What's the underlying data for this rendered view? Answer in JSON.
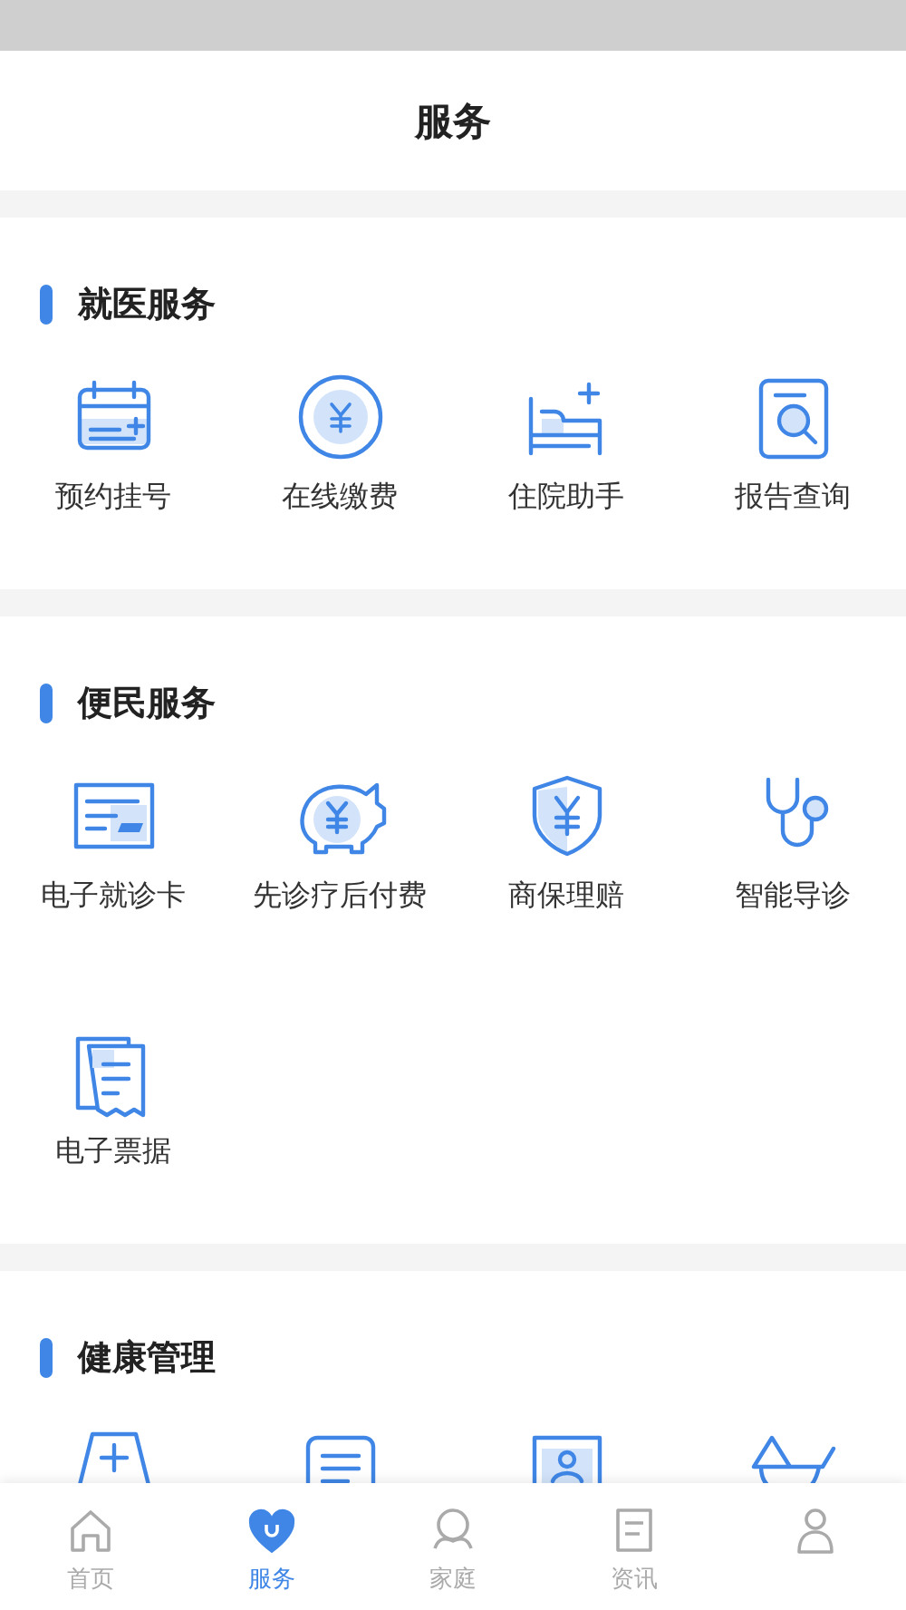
{
  "header": {
    "title": "服务"
  },
  "sections": [
    {
      "title": "就医服务",
      "items": [
        {
          "kind": "calendar",
          "label": "预约挂号"
        },
        {
          "kind": "coin",
          "label": "在线缴费"
        },
        {
          "kind": "bed",
          "label": "住院助手"
        },
        {
          "kind": "report",
          "label": "报告查询"
        }
      ]
    },
    {
      "title": "便民服务",
      "items": [
        {
          "kind": "card",
          "label": "电子就诊卡"
        },
        {
          "kind": "piggy",
          "label": "先诊疗后付费"
        },
        {
          "kind": "shield",
          "label": "商保理赔"
        },
        {
          "kind": "stethoscope",
          "label": "智能导诊"
        },
        {
          "kind": "receipt",
          "label": "电子票据"
        }
      ]
    },
    {
      "title": "健康管理",
      "items": [
        {
          "kind": "kit"
        },
        {
          "kind": "chat"
        },
        {
          "kind": "profile"
        },
        {
          "kind": "scale"
        }
      ]
    }
  ],
  "tabs": [
    {
      "kind": "home",
      "label": "首页",
      "selected": false
    },
    {
      "kind": "heart",
      "label": "服务",
      "selected": true
    },
    {
      "kind": "family",
      "label": "家庭",
      "selected": false
    },
    {
      "kind": "news",
      "label": "资讯",
      "selected": false
    },
    {
      "kind": "person",
      "selected": false
    }
  ]
}
